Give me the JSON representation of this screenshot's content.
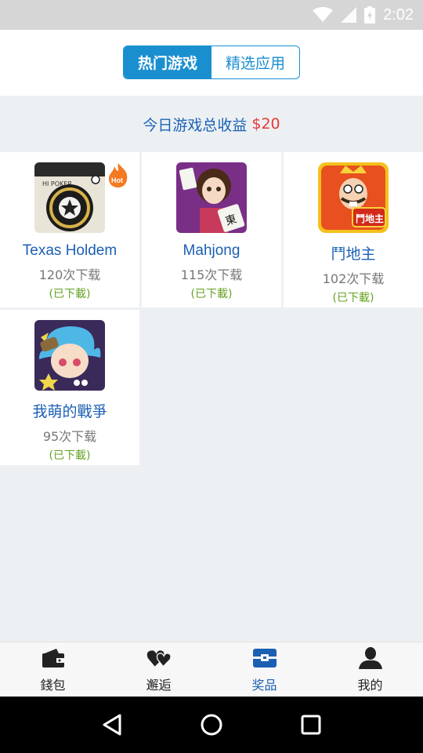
{
  "status_bar": {
    "time": "2:02"
  },
  "tabs": [
    {
      "label": "热门游戏",
      "active": true
    },
    {
      "label": "精选应用",
      "active": false
    }
  ],
  "earnings": {
    "label": "今日游戏总收益",
    "amount": "$20"
  },
  "apps": [
    {
      "name": "Texas Holdem",
      "downloads": "120次下载",
      "status": "(已下載)",
      "icon": "poker-chip-icon",
      "badge": "Hot"
    },
    {
      "name": "Mahjong",
      "downloads": "115次下载",
      "status": "(已下載)",
      "icon": "mahjong-girl-icon"
    },
    {
      "name": "鬥地主",
      "downloads": "102次下载",
      "status": "(已下載)",
      "icon": "landlord-king-icon"
    },
    {
      "name": "我萌的戰爭",
      "downloads": "95次下载",
      "status": "(已下載)",
      "icon": "cute-warrior-icon"
    }
  ],
  "poker_logo_text": "HI POKER",
  "landlord_logo_text": "鬥地主",
  "bottom_nav": [
    {
      "label": "錢包",
      "icon": "wallet-icon",
      "active": false
    },
    {
      "label": "邂逅",
      "icon": "hearts-icon",
      "active": false
    },
    {
      "label": "奖品",
      "icon": "prize-box-icon",
      "active": true
    },
    {
      "label": "我的",
      "icon": "person-icon",
      "active": false
    }
  ],
  "colors": {
    "accent": "#1a8fd0",
    "link": "#1b5fb3",
    "amount": "#e53935",
    "downloaded": "#64a221"
  }
}
